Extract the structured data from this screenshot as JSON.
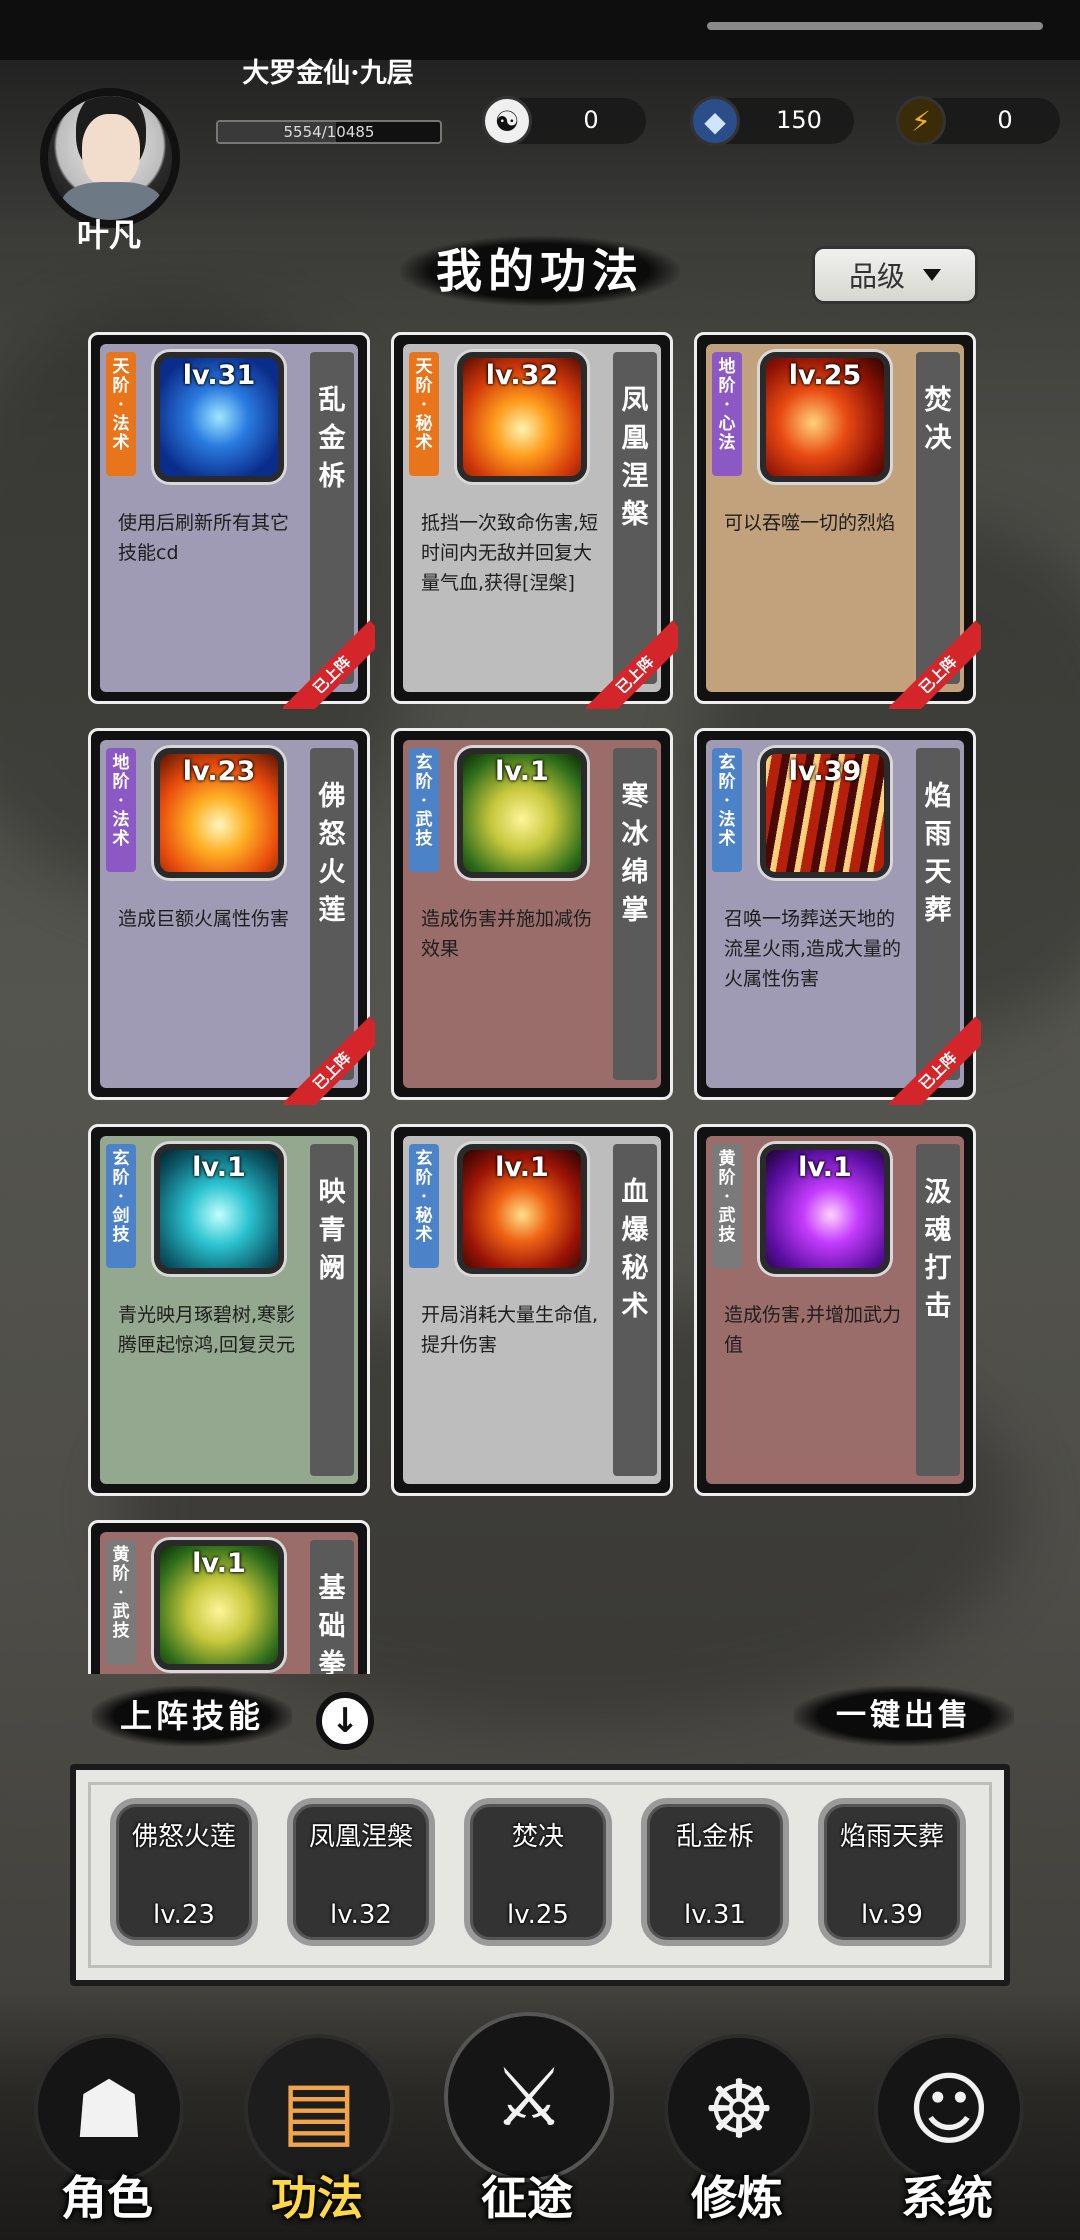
{
  "player": {
    "name": "叶凡",
    "rank_title": "大罗金仙·九层",
    "exp_text": "5554/10485",
    "exp_fraction": 0.53
  },
  "resources": [
    {
      "icon": "yin-yang-icon",
      "glyph": "☯",
      "value": "0",
      "color": "#e8e8e8"
    },
    {
      "icon": "spirit-stone-icon",
      "glyph": "◆",
      "value": "150",
      "color": "#7fb2ff"
    },
    {
      "icon": "lightning-icon",
      "glyph": "⚡",
      "value": "0",
      "color": "#f2b21c"
    }
  ],
  "section": {
    "title": "我的功法",
    "sort_label": "品级"
  },
  "skills": [
    {
      "tag": "天阶·法术",
      "tag_color": "orange",
      "level": "lv.31",
      "name": "乱金柝",
      "desc": "使用后刷新所有其它技能cd",
      "bg": "#9f9bb5",
      "art": "art-blue",
      "deployed": true
    },
    {
      "tag": "天阶·秘术",
      "tag_color": "orange",
      "level": "lv.32",
      "name": "凤凰涅槃",
      "desc": "抵挡一次致命伤害,短时间内无敌并回复大量气血,获得[涅槃]",
      "bg": "#bdbdbd",
      "art": "art-phoenix",
      "deployed": true
    },
    {
      "tag": "地阶·心法",
      "tag_color": "purple",
      "level": "lv.25",
      "name": "焚决",
      "desc": "可以吞噬一切的烈焰",
      "bg": "#c2a27d",
      "art": "art-fire",
      "deployed": true
    },
    {
      "tag": "地阶·法术",
      "tag_color": "purple",
      "level": "lv.23",
      "name": "佛怒火莲",
      "desc": "造成巨额火属性伤害",
      "bg": "#9f9bb5",
      "art": "art-lotus",
      "deployed": true
    },
    {
      "tag": "玄阶·武技",
      "tag_color": "blue",
      "level": "lv.1",
      "name": "寒冰绵掌",
      "desc": "造成伤害并施加减伤效果",
      "bg": "#9a6d6b",
      "art": "art-fist",
      "deployed": false
    },
    {
      "tag": "玄阶·法术",
      "tag_color": "blue",
      "level": "lv.39",
      "name": "焰雨天葬",
      "desc": "召唤一场葬送天地的流星火雨,造成大量的火属性伤害",
      "bg": "#9f9bb5",
      "art": "art-rain",
      "deployed": true
    },
    {
      "tag": "玄阶·剑技",
      "tag_color": "blue",
      "level": "lv.1",
      "name": "映青阙",
      "desc": "青光映月琢碧树,寒影腾匣起惊鸿,回复灵元",
      "bg": "#93a88f",
      "art": "art-cyan",
      "deployed": false
    },
    {
      "tag": "玄阶·秘术",
      "tag_color": "blue",
      "level": "lv.1",
      "name": "血爆秘术",
      "desc": "开局消耗大量生命值,提升伤害",
      "bg": "#bdbdbd",
      "art": "art-blood",
      "deployed": false
    },
    {
      "tag": "黄阶·武技",
      "tag_color": "gray",
      "level": "lv.1",
      "name": "汲魂打击",
      "desc": "造成伤害,并增加武力值",
      "bg": "#9a6d6b",
      "art": "art-purple",
      "deployed": false
    },
    {
      "tag": "黄阶·武技",
      "tag_color": "gray",
      "level": "lv.1",
      "name": "基础拳",
      "desc": "",
      "bg": "#9a6d6b",
      "art": "art-fist",
      "deployed": false
    }
  ],
  "deployed_ribbon": "已上阵",
  "deploy": {
    "label": "上阵技能",
    "sell_label": "一键出售",
    "slots": [
      {
        "name": "佛怒火莲",
        "level": "lv.23",
        "art": "art-lotus"
      },
      {
        "name": "凤凰涅槃",
        "level": "lv.32",
        "art": "art-phoenix"
      },
      {
        "name": "焚决",
        "level": "lv.25",
        "art": "art-fire"
      },
      {
        "name": "乱金柝",
        "level": "lv.31",
        "art": "art-blue"
      },
      {
        "name": "焰雨天葬",
        "level": "lv.39",
        "art": "art-rain"
      }
    ]
  },
  "nav": [
    {
      "label": "角色",
      "icon": "hooded-figure-icon",
      "glyph": "☗",
      "active": false
    },
    {
      "label": "功法",
      "icon": "scroll-book-icon",
      "glyph": "▤",
      "active": true
    },
    {
      "label": "征途",
      "icon": "sword-emblem-icon",
      "glyph": "⚔",
      "active": false
    },
    {
      "label": "修炼",
      "icon": "meditation-icon",
      "glyph": "☸",
      "active": false
    },
    {
      "label": "系统",
      "icon": "spirit-girl-icon",
      "glyph": "☺",
      "active": false
    }
  ]
}
